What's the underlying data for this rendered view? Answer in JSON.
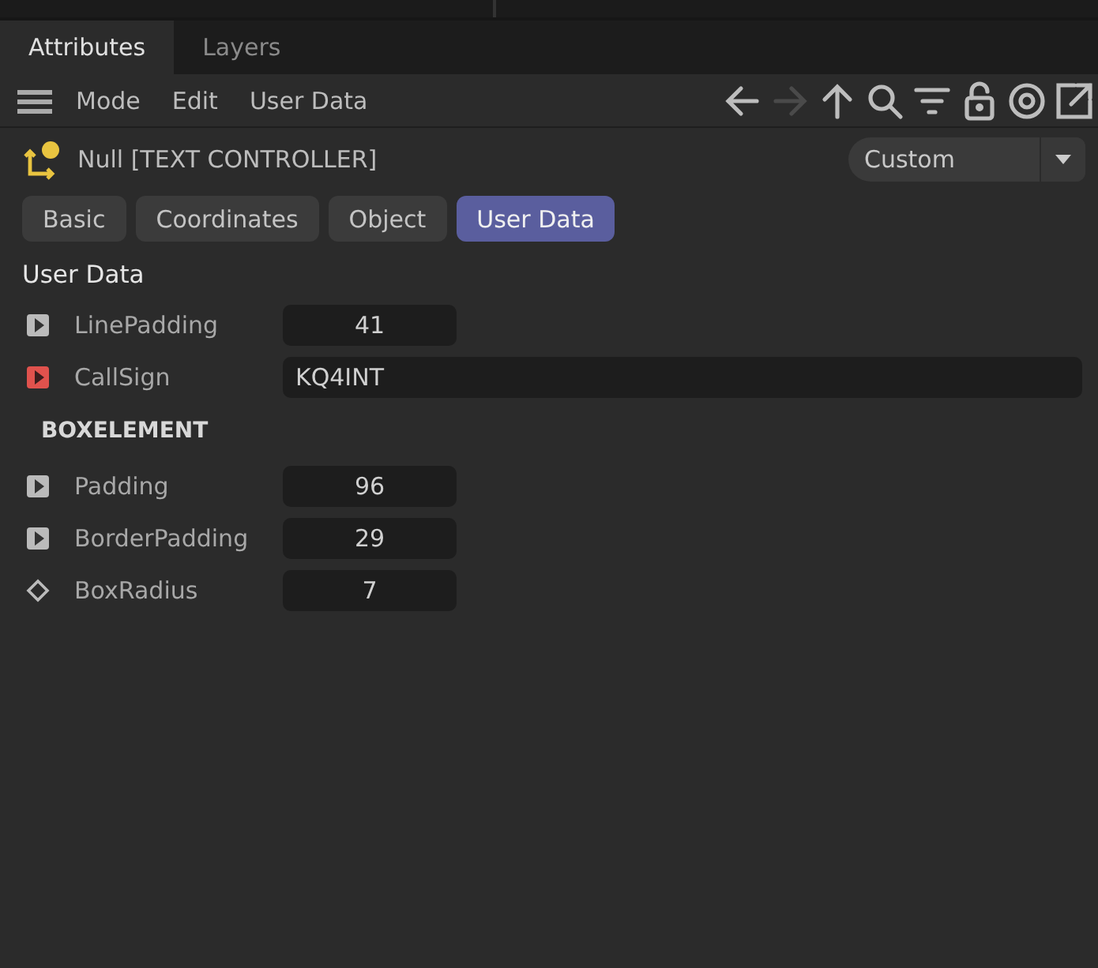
{
  "panel_tabs": [
    {
      "label": "Attributes",
      "selected": true
    },
    {
      "label": "Layers",
      "selected": false
    }
  ],
  "menu": [
    "Mode",
    "Edit",
    "User Data"
  ],
  "toolbar": [
    {
      "kind": "back",
      "disabled": false
    },
    {
      "kind": "forward",
      "disabled": true
    },
    {
      "kind": "up",
      "disabled": false
    },
    {
      "kind": "search",
      "disabled": false
    },
    {
      "kind": "filter",
      "disabled": false
    },
    {
      "kind": "lock",
      "disabled": false
    },
    {
      "kind": "target",
      "disabled": false
    },
    {
      "kind": "popout",
      "disabled": false
    }
  ],
  "object": {
    "title": "Null [TEXT CONTROLLER]",
    "preset": "Custom"
  },
  "sections": [
    {
      "label": "Basic",
      "selected": false
    },
    {
      "label": "Coordinates",
      "selected": false
    },
    {
      "label": "Object",
      "selected": false
    },
    {
      "label": "User Data",
      "selected": true
    }
  ],
  "group_title": "User Data",
  "params": [
    {
      "kind": "number",
      "label": "LinePadding",
      "value": "41",
      "animatable": true,
      "highlighted": false
    },
    {
      "kind": "text",
      "label": "CallSign",
      "value": "KQ4INT",
      "animatable": true,
      "highlighted": true
    },
    {
      "kind": "group",
      "label": "BOXELEMENT"
    },
    {
      "kind": "number",
      "label": "Padding",
      "value": "96",
      "animatable": true,
      "highlighted": false
    },
    {
      "kind": "number",
      "label": "BorderPadding",
      "value": "29",
      "animatable": true,
      "highlighted": false
    },
    {
      "kind": "number",
      "label": "BoxRadius",
      "value": "7",
      "animatable": false,
      "highlighted": false
    }
  ]
}
